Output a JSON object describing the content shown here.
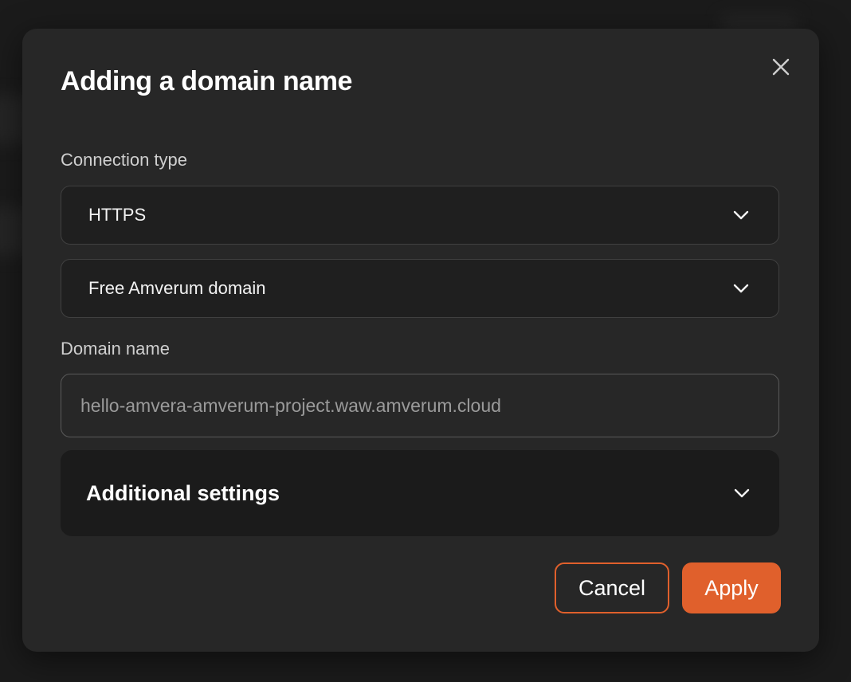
{
  "dialog": {
    "title": "Adding a domain name",
    "close_icon": "close-icon"
  },
  "connection": {
    "label": "Connection type",
    "type_value": "HTTPS",
    "domain_source_value": "Free Amverum domain"
  },
  "domain": {
    "label": "Domain name",
    "value": "",
    "placeholder": "hello-amvera-amverum-project.waw.amverum.cloud"
  },
  "additional": {
    "title": "Additional settings",
    "expanded": false
  },
  "actions": {
    "cancel_label": "Cancel",
    "apply_label": "Apply"
  },
  "colors": {
    "accent": "#e0602c",
    "modal_bg": "#272727",
    "field_bg": "#1f1f1f"
  }
}
